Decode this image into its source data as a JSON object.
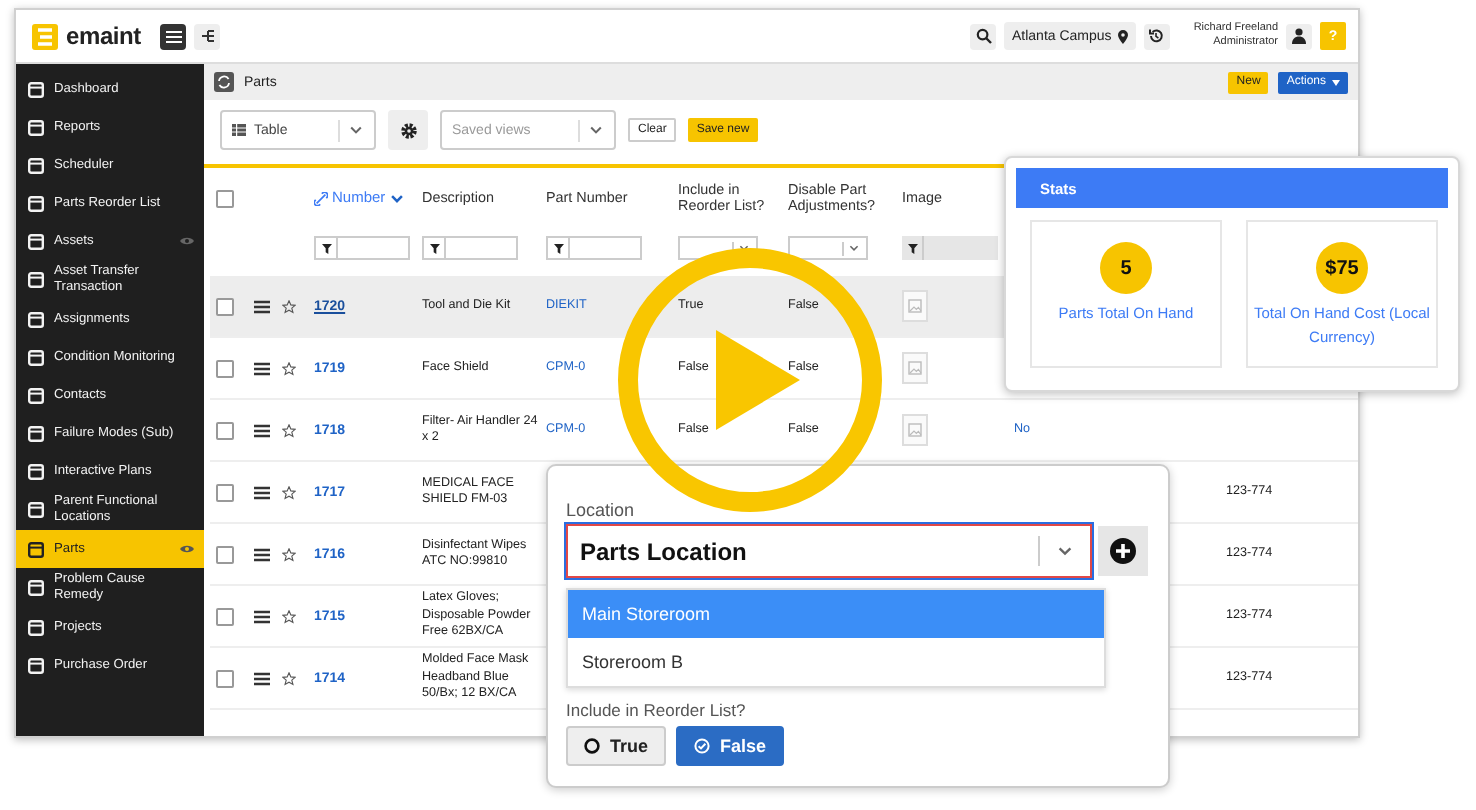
{
  "app": {
    "logo": "emaint",
    "campus": "Atlanta Campus",
    "user_name": "Richard Freeland",
    "user_role": "Administrator",
    "help_label": "?"
  },
  "sidebar": {
    "items": [
      {
        "label": "Dashboard",
        "selected": false,
        "eye": false
      },
      {
        "label": "Reports",
        "selected": false,
        "eye": false
      },
      {
        "label": "Scheduler",
        "selected": false,
        "eye": false
      },
      {
        "label": "Parts Reorder List",
        "selected": false,
        "eye": false
      },
      {
        "label": "Assets",
        "selected": false,
        "eye": true
      },
      {
        "label": "Asset Transfer Transaction",
        "selected": false,
        "eye": false
      },
      {
        "label": "Assignments",
        "selected": false,
        "eye": false
      },
      {
        "label": "Condition Monitoring",
        "selected": false,
        "eye": false
      },
      {
        "label": "Contacts",
        "selected": false,
        "eye": false
      },
      {
        "label": "Failure Modes (Sub)",
        "selected": false,
        "eye": false
      },
      {
        "label": "Interactive Plans",
        "selected": false,
        "eye": false
      },
      {
        "label": "Parent Functional Locations",
        "selected": false,
        "eye": false
      },
      {
        "label": "Parts",
        "selected": true,
        "eye": true
      },
      {
        "label": "Problem Cause Remedy",
        "selected": false,
        "eye": false
      },
      {
        "label": "Projects",
        "selected": false,
        "eye": false
      },
      {
        "label": "Purchase Order",
        "selected": false,
        "eye": false
      }
    ]
  },
  "page": {
    "title": "Parts",
    "buttons": [
      {
        "label": "New",
        "kind": "accent"
      },
      {
        "label": "Actions",
        "kind": "dropdown"
      }
    ]
  },
  "toolbar": {
    "view": "Table",
    "saved_views_placeholder": "Saved views",
    "buttons": [
      {
        "label": "Clear",
        "kind": "plain"
      },
      {
        "label": "Save new",
        "kind": "accent"
      }
    ]
  },
  "table": {
    "select_all_checked": false,
    "columns": [
      {
        "label": "Number",
        "sorted": true,
        "kind": "text"
      },
      {
        "label": "Description",
        "sorted": false,
        "kind": "text"
      },
      {
        "label": "Part Number",
        "sorted": false,
        "kind": "text"
      },
      {
        "label": "Include in Reorder List?",
        "sorted": false,
        "kind": "select"
      },
      {
        "label": "Disable Part Adjustments?",
        "sorted": false,
        "kind": "select"
      },
      {
        "label": "Image",
        "sorted": false,
        "kind": "text"
      }
    ],
    "rows": [
      {
        "number": "1720",
        "description": "Tool and Die Kit",
        "part_number": "DIEKIT",
        "include": "True",
        "disable": "False",
        "image": true,
        "checked": false,
        "selected": true
      },
      {
        "number": "1719",
        "description": "Face Shield",
        "part_number": "CPM-0",
        "include": "False",
        "disable": "False",
        "image": true,
        "checked": false,
        "selected": false
      },
      {
        "number": "1718",
        "description": "Filter- Air Handler 24 x 2",
        "part_number": "CPM-0",
        "include": "False",
        "disable": "False",
        "image": true,
        "column_10": "No",
        "checked": false,
        "selected": false
      },
      {
        "number": "1717",
        "description": "MEDICAL FACE SHIELD FM-03",
        "column_11": "123-774",
        "checked": false,
        "selected": false
      },
      {
        "number": "1716",
        "description": "Disinfectant Wipes ATC NO:99810",
        "column_11": "123-774",
        "checked": false,
        "selected": false
      },
      {
        "number": "1715",
        "description": "Latex Gloves; Disposable Powder Free 62BX/CA",
        "column_11": "123-774",
        "checked": false,
        "selected": false
      },
      {
        "number": "1714",
        "description": "Molded Face Mask Headband Blue 50/Bx; 12 BX/CA",
        "column_11": "123-774",
        "checked": false,
        "selected": false
      }
    ]
  },
  "stats": {
    "title": "Stats",
    "cards": [
      {
        "value": "5",
        "label": "Parts Total On Hand"
      },
      {
        "value": "$75",
        "label": "Total On Hand Cost (Local Currency)"
      }
    ]
  },
  "location_form": {
    "label": "Location",
    "value": "Parts Location",
    "options": [
      {
        "label": "Main Storeroom",
        "selected": true
      },
      {
        "label": "Storeroom B",
        "selected": false
      }
    ],
    "question": "Include in Reorder List?",
    "choices": [
      {
        "label": "True",
        "selected": false
      },
      {
        "label": "False",
        "selected": true
      }
    ]
  }
}
